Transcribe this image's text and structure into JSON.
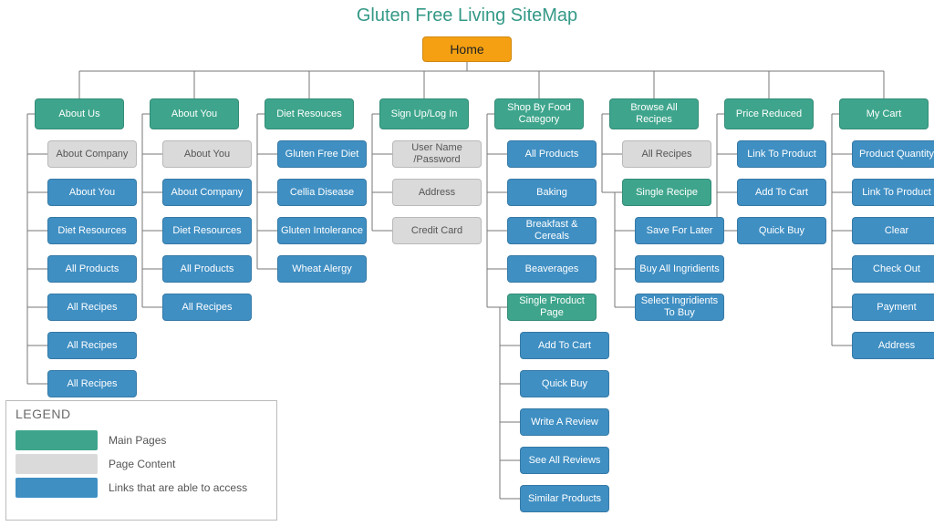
{
  "title": "Gluten Free Living SiteMap",
  "root": "Home",
  "legend": {
    "title": "LEGEND",
    "rows": [
      {
        "color": "#3ea58c",
        "label": "Main Pages"
      },
      {
        "color": "#dadada",
        "label": "Page Content"
      },
      {
        "color": "#3f8fc3",
        "label": "Links that are able to access"
      }
    ]
  },
  "columns": [
    {
      "header": "About Us",
      "items": [
        {
          "label": "About Company",
          "type": "grey"
        },
        {
          "label": "About You",
          "type": "blue"
        },
        {
          "label": "Diet Resources",
          "type": "blue"
        },
        {
          "label": "All Products",
          "type": "blue"
        },
        {
          "label": "All Recipes",
          "type": "blue"
        },
        {
          "label": "All Recipes",
          "type": "blue"
        },
        {
          "label": "All Recipes",
          "type": "blue"
        }
      ]
    },
    {
      "header": "About You",
      "items": [
        {
          "label": "About You",
          "type": "grey"
        },
        {
          "label": "About Company",
          "type": "blue"
        },
        {
          "label": "Diet Resources",
          "type": "blue"
        },
        {
          "label": "All Products",
          "type": "blue"
        },
        {
          "label": "All Recipes",
          "type": "blue"
        }
      ]
    },
    {
      "header": "Diet Resouces",
      "items": [
        {
          "label": "Gluten Free Diet",
          "type": "blue"
        },
        {
          "label": "Cellia Disease",
          "type": "blue"
        },
        {
          "label": "Gluten Intolerance",
          "type": "blue"
        },
        {
          "label": "Wheat Alergy",
          "type": "blue"
        }
      ]
    },
    {
      "header": "Sign Up/Log In",
      "items": [
        {
          "label": "User Name /Password",
          "type": "grey"
        },
        {
          "label": "Address",
          "type": "grey"
        },
        {
          "label": "Credit Card",
          "type": "grey"
        }
      ]
    },
    {
      "header": "Shop By Food Category",
      "items": [
        {
          "label": "All Products",
          "type": "blue"
        },
        {
          "label": "Baking",
          "type": "blue"
        },
        {
          "label": "Breakfast & Cereals",
          "type": "blue"
        },
        {
          "label": "Beaverages",
          "type": "blue"
        },
        {
          "label": "Single Product Page",
          "type": "green"
        },
        {
          "label": "Add To Cart",
          "type": "blue"
        },
        {
          "label": "Quick Buy",
          "type": "blue"
        },
        {
          "label": "Write A Review",
          "type": "blue"
        },
        {
          "label": "See All Reviews",
          "type": "blue"
        },
        {
          "label": "Similar Products",
          "type": "blue"
        }
      ]
    },
    {
      "header": "Browse All Recipes",
      "items": [
        {
          "label": "All Recipes",
          "type": "grey"
        },
        {
          "label": "Single Recipe",
          "type": "green"
        },
        {
          "label": "Save For Later",
          "type": "blue"
        },
        {
          "label": "Buy All Ingridients",
          "type": "blue"
        },
        {
          "label": "Select Ingridients To Buy",
          "type": "blue"
        }
      ]
    },
    {
      "header": "Price Reduced",
      "items": [
        {
          "label": "Link To Product",
          "type": "blue"
        },
        {
          "label": "Add To Cart",
          "type": "blue"
        },
        {
          "label": "Quick Buy",
          "type": "blue"
        }
      ]
    },
    {
      "header": "My Cart",
      "items": [
        {
          "label": "Product Quantity",
          "type": "blue"
        },
        {
          "label": "Link To Product",
          "type": "blue"
        },
        {
          "label": "Clear",
          "type": "blue"
        },
        {
          "label": "Check Out",
          "type": "blue"
        },
        {
          "label": "Payment",
          "type": "blue"
        },
        {
          "label": "Address",
          "type": "blue"
        }
      ]
    }
  ]
}
